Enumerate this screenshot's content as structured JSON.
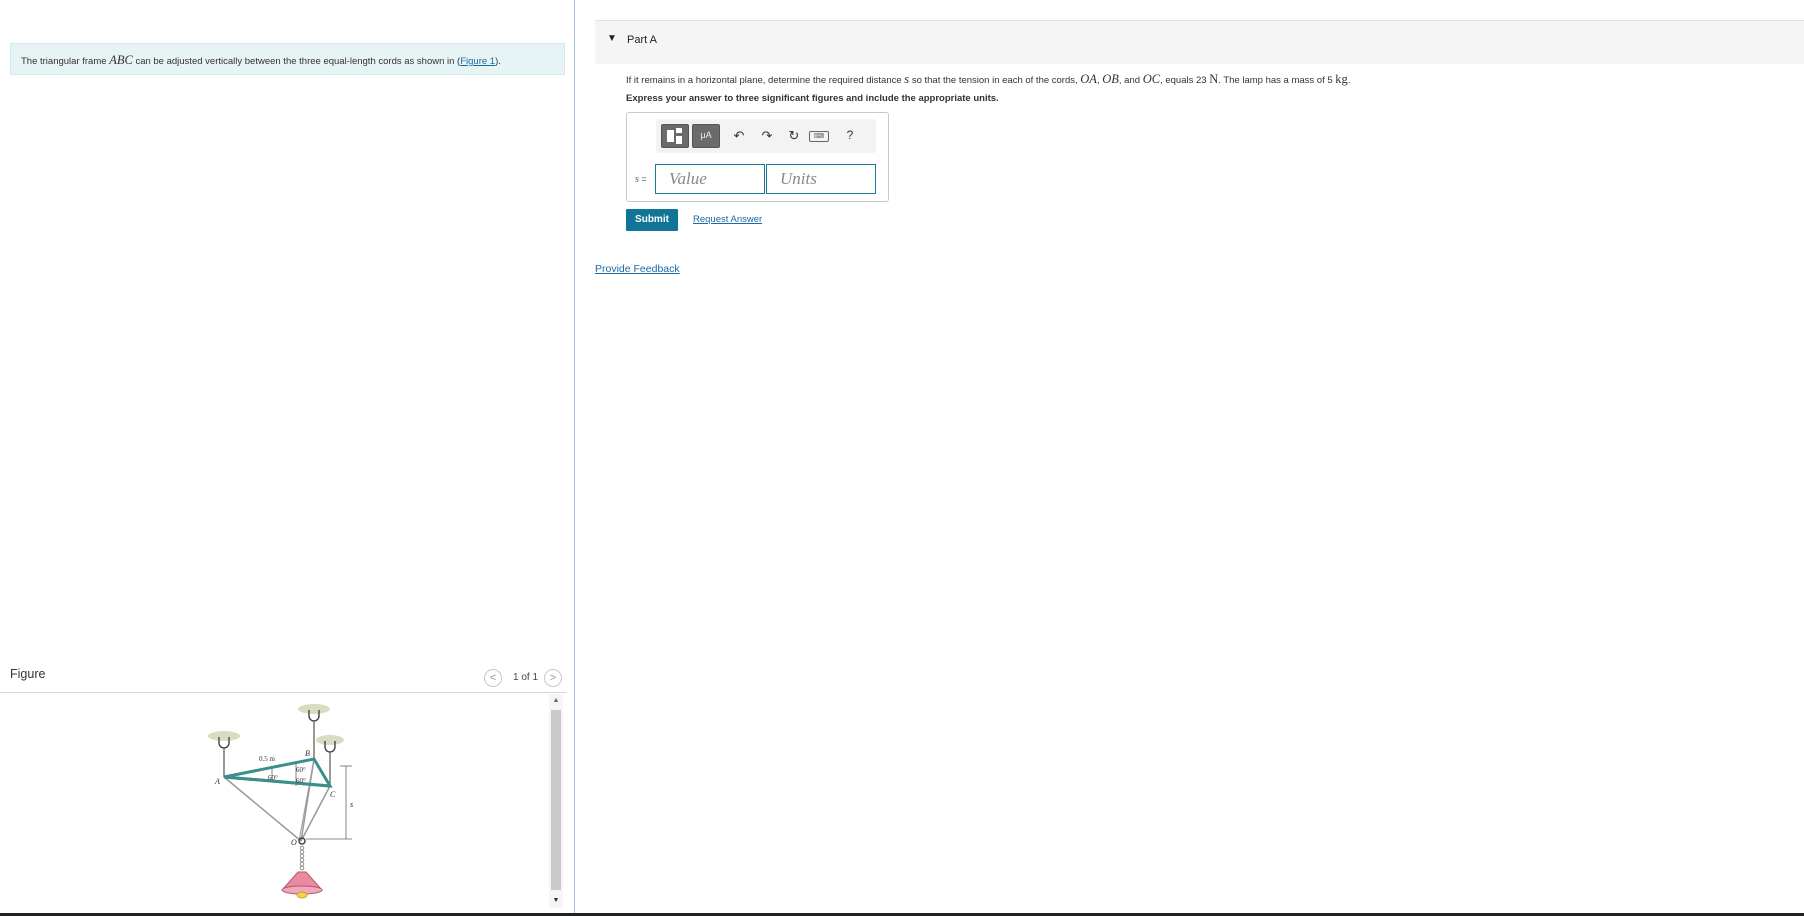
{
  "intro": {
    "text_before": "The triangular frame",
    "frame_name": "ABC",
    "text_after": "can be adjusted vertically between the three equal-length cords as shown in (",
    "figure_link": "Figure 1",
    "text_end": ")."
  },
  "figure_panel": {
    "title": "Figure",
    "pager_prev": "<",
    "pager_next": ">",
    "pager_count": "1 of 1",
    "labels": {
      "a": "A",
      "b": "B",
      "c": "C",
      "o": "O",
      "s": "s",
      "length": "0.5 m",
      "angle_a": "60°",
      "angle_b1": "60°",
      "angle_b2": "60°"
    }
  },
  "part": {
    "toggle": "▼",
    "title": "Part A"
  },
  "question": {
    "t1": "If it remains in a horizontal plane, determine the required distance",
    "var_s": "s",
    "t2": "so that the tension in each of the cords,",
    "oa": "OA",
    "comma1": ",",
    "ob": "OB",
    "t3": ", and",
    "oc": "OC",
    "t4": ", equals 23",
    "n_unit": "N",
    "t5": ". The lamp has a mass of 5",
    "kg_unit": "kg",
    "t6": "."
  },
  "instructions": "Express your answer to three significant figures and include the appropriate units.",
  "answer": {
    "toolbar": {
      "symbols_label": "μA",
      "undo_icon": "undo-icon",
      "redo_icon": "redo-icon",
      "reset_icon": "reset-icon",
      "keyboard_icon": "keyboard-icon",
      "help_label": "?"
    },
    "var_label": "s",
    "equals": "=",
    "value_placeholder": "Value",
    "units_placeholder": "Units"
  },
  "buttons": {
    "submit": "Submit",
    "request_answer": "Request Answer"
  },
  "feedback_link": "Provide Feedback",
  "colors": {
    "accent": "#107596",
    "link": "#1a6aa8",
    "intro_bg": "#e7f4f6",
    "frame_teal": "#3a8f8a",
    "lamp_pink": "#e98aa0"
  }
}
